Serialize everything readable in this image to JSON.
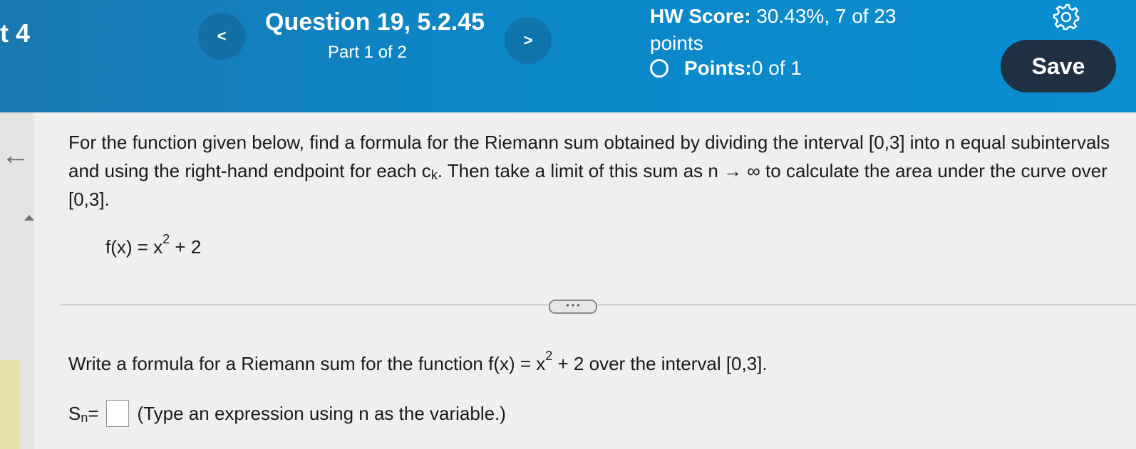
{
  "header": {
    "left_fragment": "t 4",
    "prev_label": "<",
    "next_label": ">",
    "question_title": "Question 19, 5.2.45",
    "part_label": "Part 1 of 2",
    "hw_score_label": "HW Score:",
    "hw_score_value": " 30.43%, 7 of 23",
    "hw_score_suffix": "points",
    "points_label": "Points:",
    "points_value": " 0 of 1",
    "save_label": "Save",
    "settings_icon": "gear-icon"
  },
  "sidebar": {
    "back_icon": "left-arrow-icon",
    "back_glyph": "←"
  },
  "problem": {
    "line_text_1": "For the function given below, find a formula for the Riemann sum obtained by dividing the interval [0,3] into n equal subintervals and using the right-hand endpoint for each c",
    "ck_sub": "k",
    "line_text_2": ". Then take a limit of this sum as n → ∞ to calculate the area under the curve over [0,3].",
    "function_lhs": "f(x) = x",
    "function_exp": "2",
    "function_rhs": " + 2"
  },
  "more_button": {
    "label": "• • •"
  },
  "question": {
    "prompt_pre": "Write a formula for a Riemann sum for the function f(x) = x",
    "prompt_exp": "2",
    "prompt_post": " + 2 over the interval [0,3].",
    "answer_lhs": "S",
    "answer_sub": "n",
    "answer_eq": " =",
    "hint": "(Type an expression using n as the variable.)"
  }
}
